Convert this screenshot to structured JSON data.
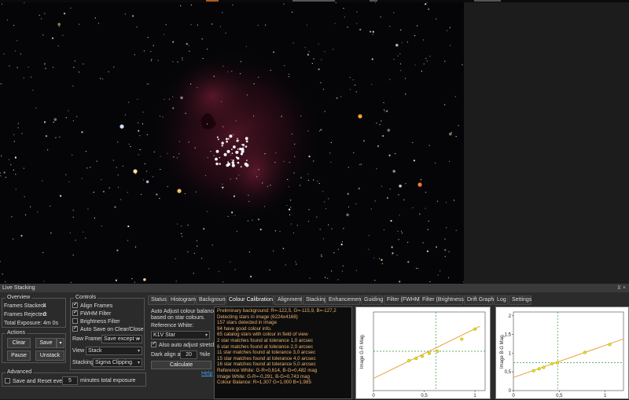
{
  "panel": {
    "title": "Live Stacking",
    "pin_glyph": "⊻ ×"
  },
  "overview": {
    "title": "Overview",
    "frames_stacked_label": "Frames Stacked:",
    "frames_stacked": "4",
    "frames_rejected_label": "Frames Rejected:",
    "frames_rejected": "0",
    "total_exposure_label": "Total Exposure:",
    "total_exposure": "4m 0s"
  },
  "actions": {
    "title": "Actions",
    "clear": "Clear",
    "save": "Save",
    "pause": "Pause",
    "unstack": "Unstack"
  },
  "advanced": {
    "title": "Advanced",
    "save_reset_label": "Save and Reset every",
    "save_reset_value": "5",
    "save_reset_suffix": "minutes total exposure"
  },
  "controls": {
    "title": "Controls",
    "align_frames": "Align Frames",
    "fwhm_filter": "FWHM Filter",
    "brightness_filter": "Brightness Filter",
    "auto_save": "Auto Save on Clear/Close",
    "raw_frames_label": "Raw Frames",
    "raw_frames_value": "Save except w",
    "view_label": "View",
    "view_value": "Stack",
    "stacking_label": "Stacking",
    "stacking_value": "Sigma Clipping"
  },
  "tabs": [
    "Status",
    "Histogram",
    "Background",
    "Colour Calibration",
    "Alignment",
    "Stacking",
    "Enhancement",
    "Guiding",
    "Filter (FWHM)",
    "Filter (Brightness)",
    "Drift Graph",
    "Log",
    "Settings"
  ],
  "calibration": {
    "description_line1": "Auto Adjust colour balance",
    "description_line2": "based on star colours.",
    "reference_white_label": "Reference White:",
    "reference_white_value": "K1V Star",
    "auto_stretch": "Also auto adjust stretch",
    "dark_align_label": "Dark align at",
    "dark_align_value": "20",
    "dark_align_suffix": "%ile",
    "calculate": "Calculate",
    "help": "Help"
  },
  "log_lines": [
    "Preliminary background:     R=-122,5, G=-115,9, B=-127,2",
    "Detecting stars in image (6224x4168)",
    "157 stars detected in image",
    "94 have good colour info.",
    "65 catalog stars with colour in field of view",
    "2 star matches found at tolerance 1,0 arcsec",
    "6 star matches found at tolerance 2,0 arcsec",
    "11 star matches found at tolerance 3,0 arcsec",
    "15 star matches found at tolerance 4,0 arcsec",
    "16 star matches found at tolerance 5,0 arcsec",
    "Reference White:   G-R=0,614, B-G=0,482 mag",
    "Image White:        G-R=-0,291, B-G=0,743 mag",
    "Colour Balance:     R=1,307 G=1,000 B=1,985"
  ],
  "graph_gr": {
    "ylabel": "Image G-R Mag.",
    "x_ticks": [
      "0",
      "0,5",
      "1"
    ],
    "points": [
      [
        0.35,
        0.42
      ],
      [
        0.42,
        0.45
      ],
      [
        0.48,
        0.48
      ],
      [
        0.55,
        0.52
      ],
      [
        0.63,
        0.55
      ],
      [
        0.87,
        0.72
      ],
      [
        1.0,
        0.86
      ]
    ],
    "fit": [
      [
        0.0,
        0.17
      ],
      [
        1.05,
        0.9
      ]
    ],
    "ref_x": 0.614,
    "ref_y": 0.55,
    "x_range": [
      0,
      1.1
    ],
    "y_range": [
      0,
      1.1
    ],
    "colors": {
      "fit": "#e8a23a",
      "points": "#e6e600",
      "ref": "#2a9a3a"
    }
  },
  "graph_bg": {
    "ylabel": "Image B-G Mag.",
    "x_ticks": [
      "0",
      "0,5",
      "1"
    ],
    "y_ticks": [
      "0",
      "0,5",
      "1",
      "1,5",
      "2"
    ],
    "points": [
      [
        0.22,
        0.53
      ],
      [
        0.28,
        0.58
      ],
      [
        0.33,
        0.62
      ],
      [
        0.42,
        0.72
      ],
      [
        0.48,
        0.74
      ],
      [
        0.78,
        1.02
      ],
      [
        1.05,
        1.23
      ]
    ],
    "fit": [
      [
        0.0,
        0.35
      ],
      [
        1.2,
        1.38
      ]
    ],
    "ref_x": 0.482,
    "ref_y": 0.743,
    "x_range": [
      0,
      1.2
    ],
    "y_range": [
      0,
      2.1
    ],
    "colors": {
      "fit": "#e8a23a",
      "points": "#e6e600",
      "ref": "#2a9a3a"
    }
  }
}
